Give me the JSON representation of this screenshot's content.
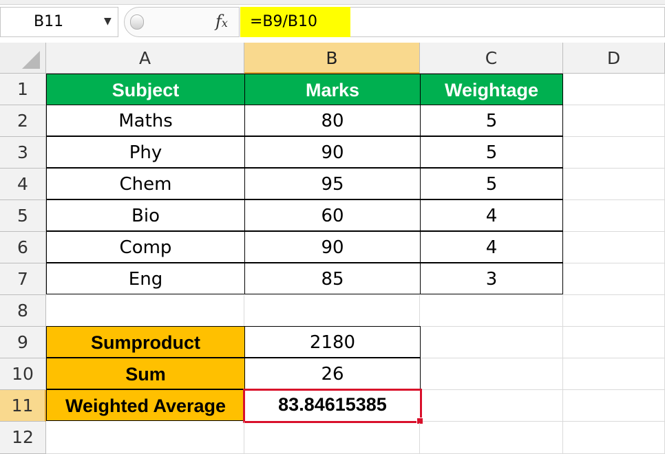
{
  "formula_bar": {
    "name_box": "B11",
    "fx": "fx",
    "formula": "=B9/B10"
  },
  "columns": [
    "A",
    "B",
    "C",
    "D"
  ],
  "rows": [
    "1",
    "2",
    "3",
    "4",
    "5",
    "6",
    "7",
    "8",
    "9",
    "10",
    "11",
    "12"
  ],
  "table": {
    "headers": [
      "Subject",
      "Marks",
      "Weightage"
    ],
    "data": [
      [
        "Maths",
        "80",
        "5"
      ],
      [
        "Phy",
        "90",
        "5"
      ],
      [
        "Chem",
        "95",
        "5"
      ],
      [
        "Bio",
        "60",
        "4"
      ],
      [
        "Comp",
        "90",
        "4"
      ],
      [
        "Eng",
        "85",
        "3"
      ]
    ]
  },
  "summary": {
    "sumproduct_label": "Sumproduct",
    "sumproduct_value": "2180",
    "sum_label": "Sum",
    "sum_value": "26",
    "weighted_label": "Weighted Average",
    "weighted_value": "83.84615385"
  },
  "colors": {
    "header_green": "#00b050",
    "label_orange": "#ffc000",
    "formula_highlight": "#ffff00",
    "result_border": "#d9102b",
    "selected_header": "#f9d98e"
  }
}
